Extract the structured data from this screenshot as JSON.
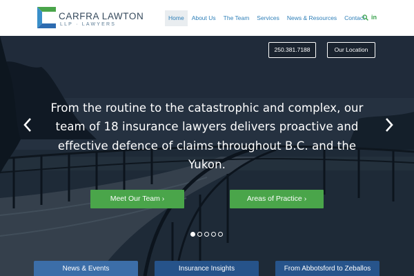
{
  "brand": {
    "name": "CARFRA LAWTON",
    "subtitle": "LLP · LAWYERS",
    "colors": {
      "logo_green": "#4aa54a",
      "logo_blue": "#2d6bb0",
      "nav_text": "#2e7fb8",
      "accent_green": "#4aa54a",
      "tab_blue": "#2d5d96"
    }
  },
  "nav": {
    "items": [
      {
        "label": "Home",
        "active": true
      },
      {
        "label": "About Us",
        "active": false
      },
      {
        "label": "The Team",
        "active": false
      },
      {
        "label": "Services",
        "active": false
      },
      {
        "label": "News & Resources",
        "active": false
      },
      {
        "label": "Contact",
        "active": false
      }
    ],
    "search_icon": "search-icon",
    "social_icon": "linkedin-icon",
    "social_label": "in"
  },
  "hero": {
    "phone": "250.381.7188",
    "location": "Our Location",
    "headline": "From the routine to the catastrophic and complex, our team of 18 insurance lawyers delivers proactive and effective defence of claims throughout B.C. and the Yukon.",
    "cta_team": "Meet Our Team",
    "cta_practice": "Areas of Practice",
    "cta_chevron": "›",
    "slides_total": 5,
    "slide_active": 1,
    "arrow_left_icon": "chevron-left-icon",
    "arrow_right_icon": "chevron-right-icon"
  },
  "tabs": [
    {
      "label": "News & Events"
    },
    {
      "label": "Insurance Insights"
    },
    {
      "label": "From Abbotsford to Zeballos"
    }
  ]
}
